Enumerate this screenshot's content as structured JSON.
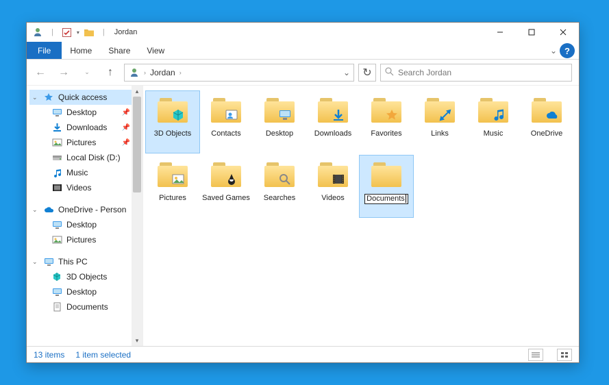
{
  "title": "Jordan",
  "ribbon": {
    "file": "File",
    "home": "Home",
    "share": "Share",
    "view": "View"
  },
  "breadcrumb": {
    "current": "Jordan"
  },
  "search": {
    "placeholder": "Search Jordan"
  },
  "nav": {
    "quick_access": "Quick access",
    "qa_items": [
      {
        "label": "Desktop",
        "icon": "desktop"
      },
      {
        "label": "Downloads",
        "icon": "downloads"
      },
      {
        "label": "Pictures",
        "icon": "pictures"
      },
      {
        "label": "Local Disk (D:)",
        "icon": "drive"
      },
      {
        "label": "Music",
        "icon": "music"
      },
      {
        "label": "Videos",
        "icon": "videos"
      }
    ],
    "onedrive": "OneDrive - Person",
    "od_items": [
      {
        "label": "Desktop"
      },
      {
        "label": "Pictures"
      }
    ],
    "thispc": "This PC",
    "pc_items": [
      {
        "label": "3D Objects"
      },
      {
        "label": "Desktop"
      },
      {
        "label": "Documents"
      }
    ]
  },
  "items": [
    {
      "label": "3D Objects",
      "overlay": "cube",
      "selected": true
    },
    {
      "label": "Contacts",
      "overlay": "contact"
    },
    {
      "label": "Desktop",
      "overlay": "desktop"
    },
    {
      "label": "Downloads",
      "overlay": "download"
    },
    {
      "label": "Favorites",
      "overlay": "star"
    },
    {
      "label": "Links",
      "overlay": "link"
    },
    {
      "label": "Music",
      "overlay": "music"
    },
    {
      "label": "OneDrive",
      "overlay": "cloud"
    },
    {
      "label": "Pictures",
      "overlay": "picture"
    },
    {
      "label": "Saved Games",
      "overlay": "game"
    },
    {
      "label": "Searches",
      "overlay": "search"
    },
    {
      "label": "Videos",
      "overlay": "video"
    },
    {
      "label": "Documents",
      "overlay": "none",
      "renaming": true
    }
  ],
  "status": {
    "count": "13 items",
    "selection": "1 item selected"
  }
}
